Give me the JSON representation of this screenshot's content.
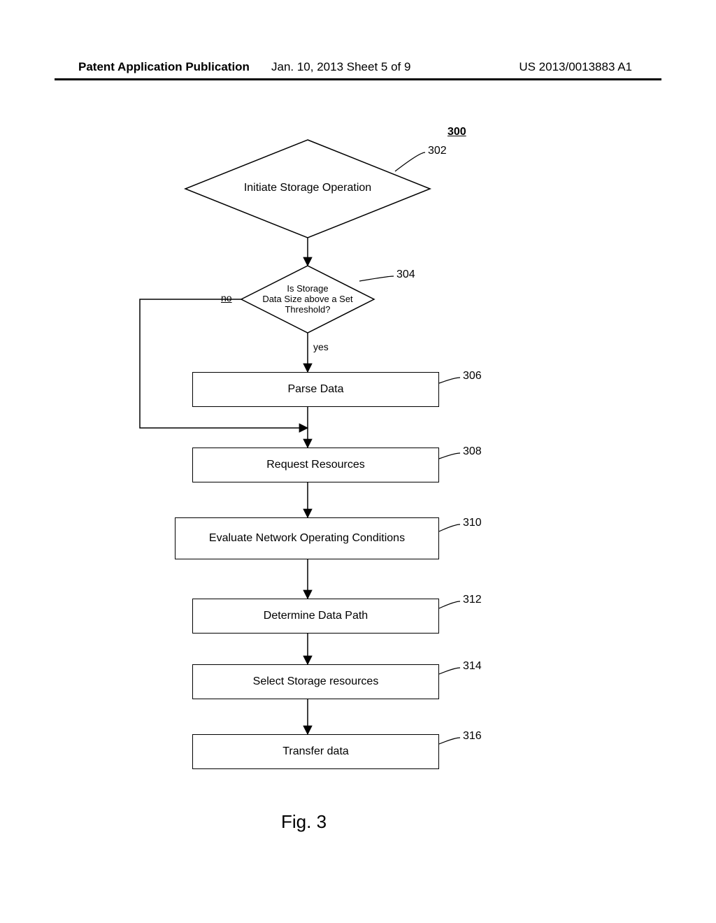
{
  "header": {
    "left": "Patent Application Publication",
    "mid": "Jan. 10, 2013  Sheet 5 of 9",
    "right": "US 2013/0013883 A1"
  },
  "figure_ref": "300",
  "figure_label": "Fig. 3",
  "nodes": {
    "n302": {
      "text": "Initiate Storage Operation",
      "ref": "302"
    },
    "n304": {
      "text": "Is Storage\nData Size above a Set\nThreshold?",
      "ref": "304"
    },
    "n306": {
      "text": "Parse Data",
      "ref": "306"
    },
    "n308": {
      "text": "Request Resources",
      "ref": "308"
    },
    "n310": {
      "text": "Evaluate Network Operating Conditions",
      "ref": "310"
    },
    "n312": {
      "text": "Determine Data Path",
      "ref": "312"
    },
    "n314": {
      "text": "Select Storage resources",
      "ref": "314"
    },
    "n316": {
      "text": "Transfer data",
      "ref": "316"
    }
  },
  "edges": {
    "no": "no",
    "yes": "yes"
  },
  "chart_data": {
    "type": "flowchart",
    "title": "Fig. 3",
    "ref": "300",
    "nodes": [
      {
        "id": "302",
        "shape": "diamond",
        "label": "Initiate Storage Operation"
      },
      {
        "id": "304",
        "shape": "diamond",
        "label": "Is Storage Data Size above a Set Threshold?"
      },
      {
        "id": "306",
        "shape": "process",
        "label": "Parse Data"
      },
      {
        "id": "308",
        "shape": "process",
        "label": "Request Resources"
      },
      {
        "id": "310",
        "shape": "process",
        "label": "Evaluate Network Operating Conditions"
      },
      {
        "id": "312",
        "shape": "process",
        "label": "Determine Data Path"
      },
      {
        "id": "314",
        "shape": "process",
        "label": "Select Storage resources"
      },
      {
        "id": "316",
        "shape": "process",
        "label": "Transfer data"
      }
    ],
    "edges": [
      {
        "from": "302",
        "to": "304",
        "label": ""
      },
      {
        "from": "304",
        "to": "306",
        "label": "yes"
      },
      {
        "from": "304",
        "to": "308",
        "label": "no"
      },
      {
        "from": "306",
        "to": "308",
        "label": ""
      },
      {
        "from": "308",
        "to": "310",
        "label": ""
      },
      {
        "from": "310",
        "to": "312",
        "label": ""
      },
      {
        "from": "312",
        "to": "314",
        "label": ""
      },
      {
        "from": "314",
        "to": "316",
        "label": ""
      }
    ]
  }
}
